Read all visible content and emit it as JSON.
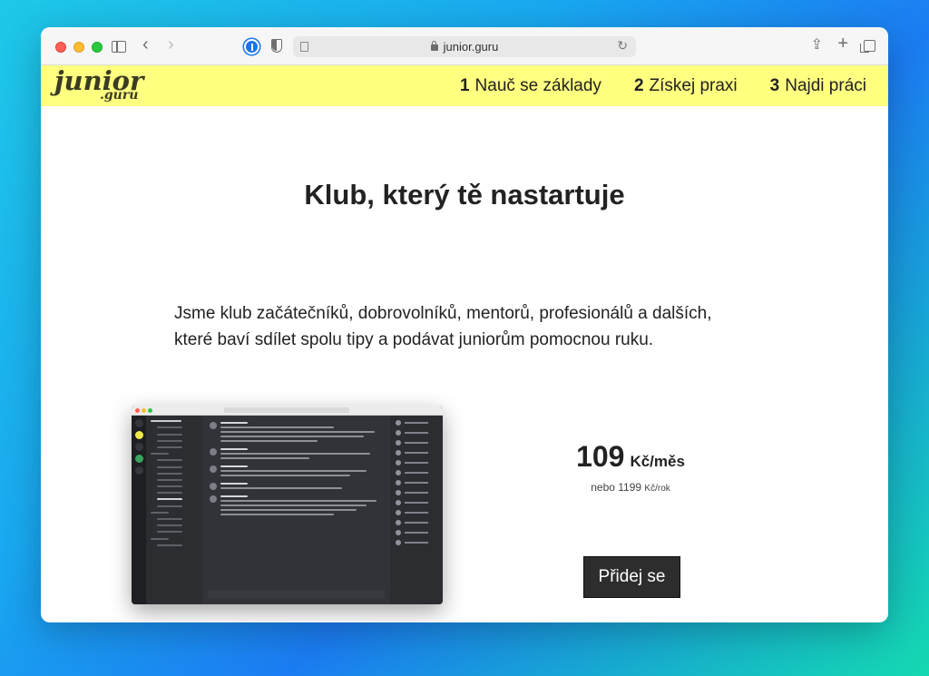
{
  "browser": {
    "url": "junior.guru"
  },
  "site": {
    "logo_main": "junior",
    "logo_sub": ".guru",
    "nav": [
      {
        "num": "1",
        "label": "Nauč se základy"
      },
      {
        "num": "2",
        "label": "Získej praxi"
      },
      {
        "num": "3",
        "label": "Najdi práci"
      }
    ]
  },
  "main": {
    "title": "Klub, který tě nastartuje",
    "lead_line1": "Jsme klub začátečníků, dobrovolníků, mentorů, profesionálů a dalších,",
    "lead_line2": "které baví sdílet spolu tipy a podávat juniorům pomocnou ruku."
  },
  "pricing": {
    "price": "109",
    "unit": "Kč/měs",
    "alt_prefix": "nebo 1199",
    "alt_unit": "Kč/rok",
    "cta_label": "Přidej se"
  },
  "colors": {
    "nav_bg": "#ffff80",
    "cta_bg": "#2d2d2d"
  }
}
